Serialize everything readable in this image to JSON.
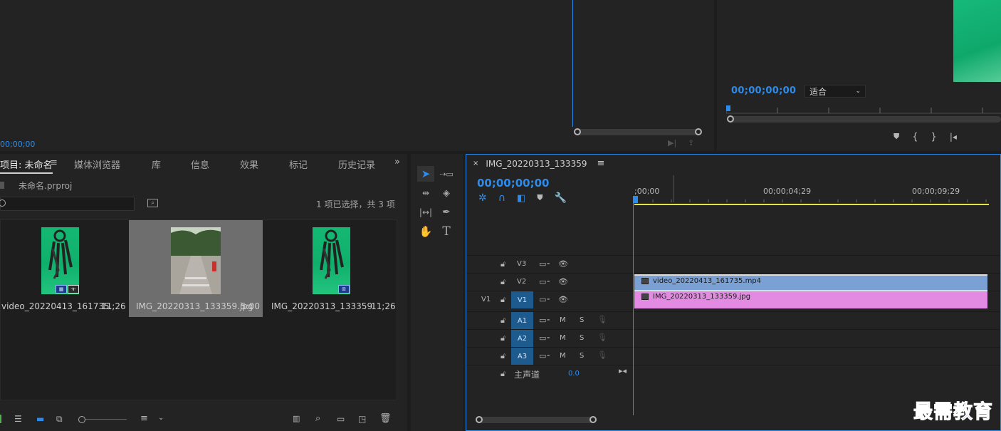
{
  "source_monitor": {
    "timecode": "00;00;00"
  },
  "program_monitor": {
    "timecode": "00;00;00;00",
    "zoom_selected": "适合"
  },
  "project_panel": {
    "tabs": [
      {
        "label": "项目: 未命名"
      },
      {
        "label": "媒体浏览器"
      },
      {
        "label": "库"
      },
      {
        "label": "信息"
      },
      {
        "label": "效果"
      },
      {
        "label": "标记"
      },
      {
        "label": "历史记录"
      }
    ],
    "project_file": "未命名.prproj",
    "selection_status": "1 项已选择，共 3 项",
    "items": [
      {
        "name": "video_20220413_161735...",
        "duration": "11;26",
        "selected": false
      },
      {
        "name": "IMG_20220313_133359.jpg",
        "duration": "5:00",
        "selected": true
      },
      {
        "name": "IMG_20220313_133359",
        "duration": "11;26",
        "selected": false
      }
    ]
  },
  "timeline": {
    "sequence_name": "IMG_20220313_133359",
    "timecode": "00;00;00;00",
    "ruler_labels": [
      ";00;00",
      "00;00;04;29",
      "00;00;09;29"
    ],
    "tracks": {
      "video": [
        {
          "name": "V3",
          "source": ""
        },
        {
          "name": "V2",
          "source": ""
        },
        {
          "name": "V1",
          "source": "V1"
        }
      ],
      "audio": [
        {
          "name": "A1",
          "mute": "M",
          "solo": "S"
        },
        {
          "name": "A2",
          "mute": "M",
          "solo": "S"
        },
        {
          "name": "A3",
          "mute": "M",
          "solo": "S"
        }
      ],
      "master": {
        "label": "主声道",
        "value": "0.0"
      }
    },
    "clips": [
      {
        "name": "video_20220413_161735.mp4",
        "track": "V2",
        "color": "#7aa0d4"
      },
      {
        "name": "IMG_20220313_133359.jpg",
        "track": "V1",
        "color": "#e38ae2"
      }
    ]
  },
  "watermark": "最需教育",
  "colors": {
    "accent": "#2d8ceb",
    "work_area": "#e3e34a",
    "target_on": "#1d5b8f"
  }
}
